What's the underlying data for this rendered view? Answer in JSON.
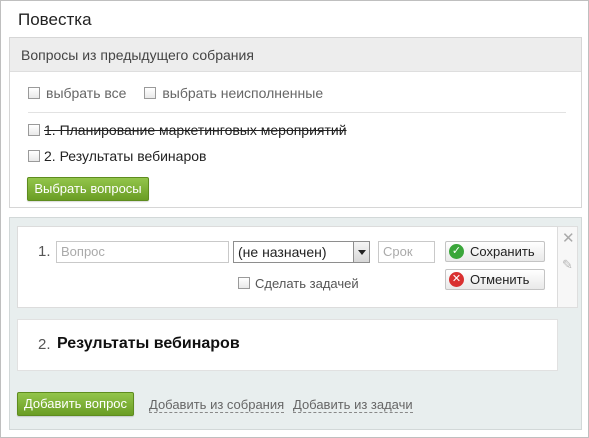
{
  "header": {
    "title": "Повестка"
  },
  "previous_meeting": {
    "title": "Вопросы из предыдущего собрания",
    "select_all": "выбрать все",
    "select_unfinished": "выбрать неисполненные",
    "items": [
      {
        "label": "1. Планирование маркетинговых мероприятий",
        "checked": false,
        "struck": true
      },
      {
        "label": "2. Результаты вебинаров",
        "checked": false,
        "struck": false
      }
    ],
    "select_button": "Выбрать вопросы"
  },
  "agenda": {
    "edit_item": {
      "number": "1.",
      "question_placeholder": "Вопрос",
      "assignee_value": "(не назначен)",
      "deadline_placeholder": "Срок",
      "make_task_label": "Сделать задачей",
      "save_label": "Сохранить",
      "cancel_label": "Отменить"
    },
    "items": [
      {
        "number": "2.",
        "label": "Результаты вебинаров"
      }
    ],
    "add_question_button": "Добавить вопрос",
    "add_from_meeting": "Добавить из собрания",
    "add_from_task": "Добавить из задачи"
  },
  "colors": {
    "accent_green": "#6a9d24",
    "save_icon": "#3aa63a",
    "cancel_icon": "#d93030",
    "agenda_background": "#e8eeee"
  },
  "icons": [
    "checkbox",
    "dropdown-arrow",
    "check-circle-icon",
    "cross-circle-icon",
    "close-icon",
    "pencil-icon"
  ]
}
